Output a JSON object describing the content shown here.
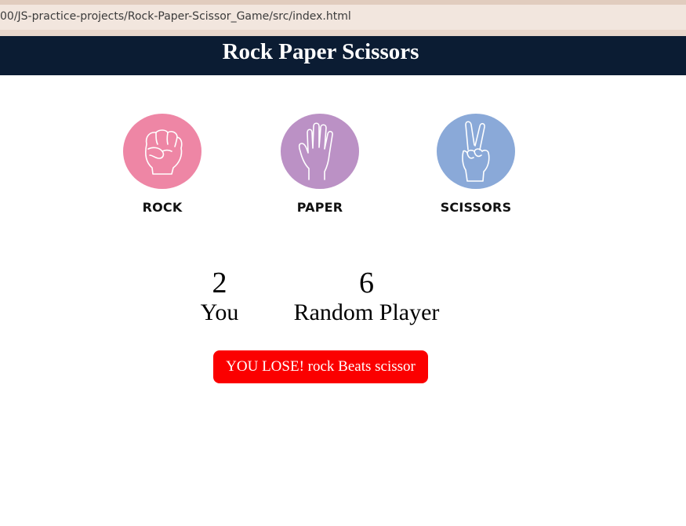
{
  "browser": {
    "url": "00/JS-practice-projects/Rock-Paper-Scissor_Game/src/index.html"
  },
  "header": {
    "title": "Rock Paper Scissors"
  },
  "choices": [
    {
      "label": "ROCK",
      "color": "#ee86a5",
      "icon": "fist-icon"
    },
    {
      "label": "PAPER",
      "color": "#bb91c5",
      "icon": "open-hand-icon"
    },
    {
      "label": "SCISSORS",
      "color": "#8aa9d8",
      "icon": "peace-hand-icon"
    }
  ],
  "scores": {
    "you": {
      "value": "2",
      "label": "You"
    },
    "random": {
      "value": "6",
      "label": "Random Player"
    }
  },
  "result": {
    "message": "YOU LOSE! rock Beats scissor",
    "color": "#fb0000"
  }
}
